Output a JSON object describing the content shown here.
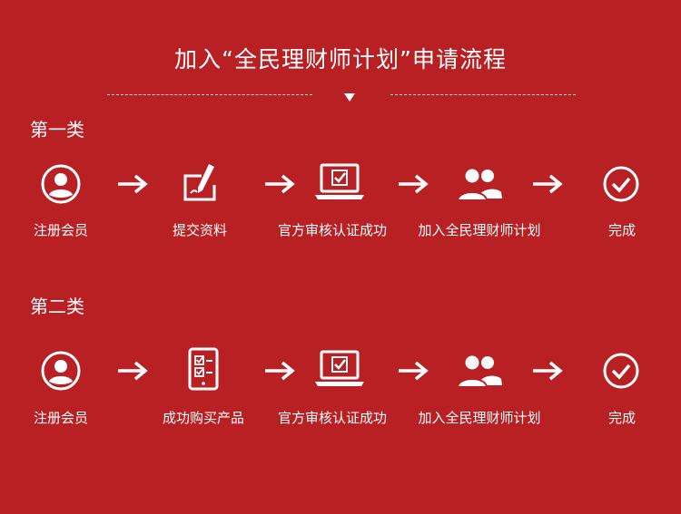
{
  "page": {
    "title": "加入“全民理财师计划”申请流程",
    "background_color": "#b82024",
    "foreground_color": "#ffffff"
  },
  "sections": [
    {
      "label": "第一类",
      "steps": [
        {
          "label": "注册会员",
          "icon": "user-circle-icon"
        },
        {
          "label": "提交资料",
          "icon": "pen-document-icon"
        },
        {
          "label": "官方审核认证成功",
          "icon": "laptop-check-icon"
        },
        {
          "label": "加入全民理财师计划",
          "icon": "users-group-icon"
        },
        {
          "label": "完成",
          "icon": "check-circle-icon"
        }
      ]
    },
    {
      "label": "第二类",
      "steps": [
        {
          "label": "注册会员",
          "icon": "user-circle-icon"
        },
        {
          "label": "成功购买产品",
          "icon": "tablet-checklist-icon"
        },
        {
          "label": "官方审核认证成功",
          "icon": "laptop-check-icon"
        },
        {
          "label": "加入全民理财师计划",
          "icon": "users-group-icon"
        },
        {
          "label": "完成",
          "icon": "check-circle-icon"
        }
      ]
    }
  ]
}
